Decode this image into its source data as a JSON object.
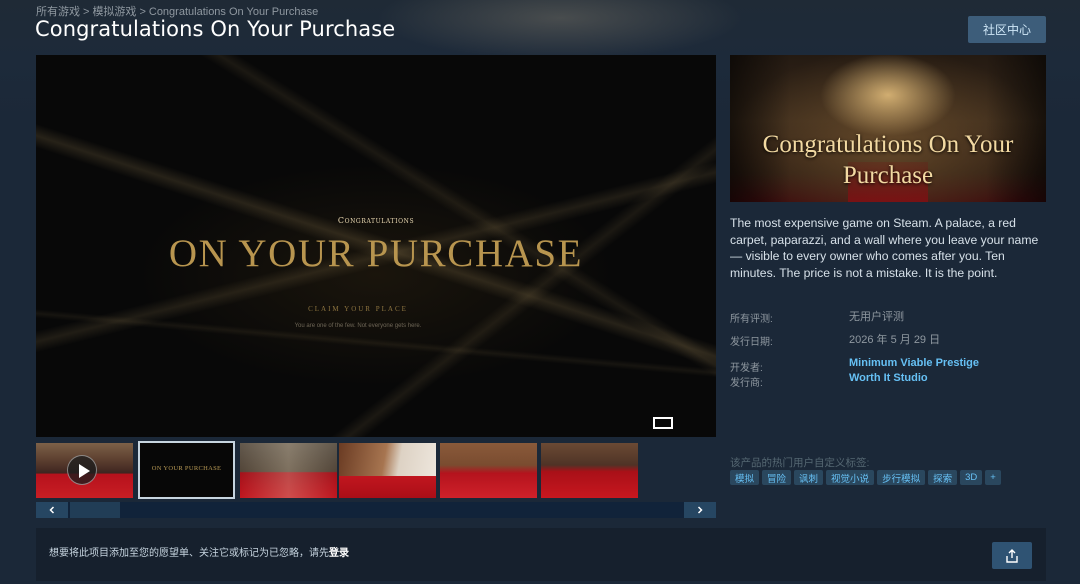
{
  "breadcrumb": {
    "items": [
      "所有游戏",
      "模拟游戏",
      "Congratulations On Your Purchase"
    ],
    "separator": ">"
  },
  "page": {
    "title": "Congratulations On Your Purchase",
    "community_button": "社区中心"
  },
  "player": {
    "small_heading": "Congratulations",
    "headline": "ON YOUR PURCHASE",
    "claim_line": "CLAIM YOUR PLACE",
    "sub_line": "You are one of the few. Not everyone gets here.",
    "controls": [
      "widescreen-icon",
      "fullscreen-icon"
    ]
  },
  "thumbnails": [
    {
      "kind": "video",
      "icon": "play-icon"
    },
    {
      "kind": "screenshot",
      "caption": "ON YOUR PURCHASE",
      "selected": true
    },
    {
      "kind": "screenshot"
    },
    {
      "kind": "screenshot"
    },
    {
      "kind": "screenshot"
    },
    {
      "kind": "screenshot"
    }
  ],
  "capsule": {
    "title_line1": "Congratulations On Your",
    "title_line2": "Purchase"
  },
  "description": "The most expensive game on Steam. A palace, a red carpet, paparazzi, and a wall where you leave your name — visible to every owner who comes after you. Ten minutes. The price is not a mistake. It is the point.",
  "meta": {
    "reviews_label": "所有评测:",
    "reviews_value": "无用户评测",
    "release_label": "发行日期:",
    "release_value": "2026 年 5 月 29 日",
    "developer_label": "开发者:",
    "developer_value": "Minimum Viable Prestige",
    "publisher_label": "发行商:",
    "publisher_value": "Worth It Studio"
  },
  "tags": {
    "label": "该产品的热门用户自定义标签:",
    "items": [
      "模拟",
      "冒险",
      "讽刺",
      "视觉小说",
      "步行模拟",
      "探索",
      "3D",
      "+"
    ]
  },
  "login_bar": {
    "prefix": "想要将此项目添加至您的愿望单、关注它或标记为已忽略，请先",
    "link": "登录",
    "share_icon": "share-icon"
  },
  "colors": {
    "background": "#1b2838",
    "accent_link": "#66c0f4",
    "tag_bg": "#2a475e",
    "button_bg": "#3d5d7a",
    "gold": "#b8954f"
  }
}
